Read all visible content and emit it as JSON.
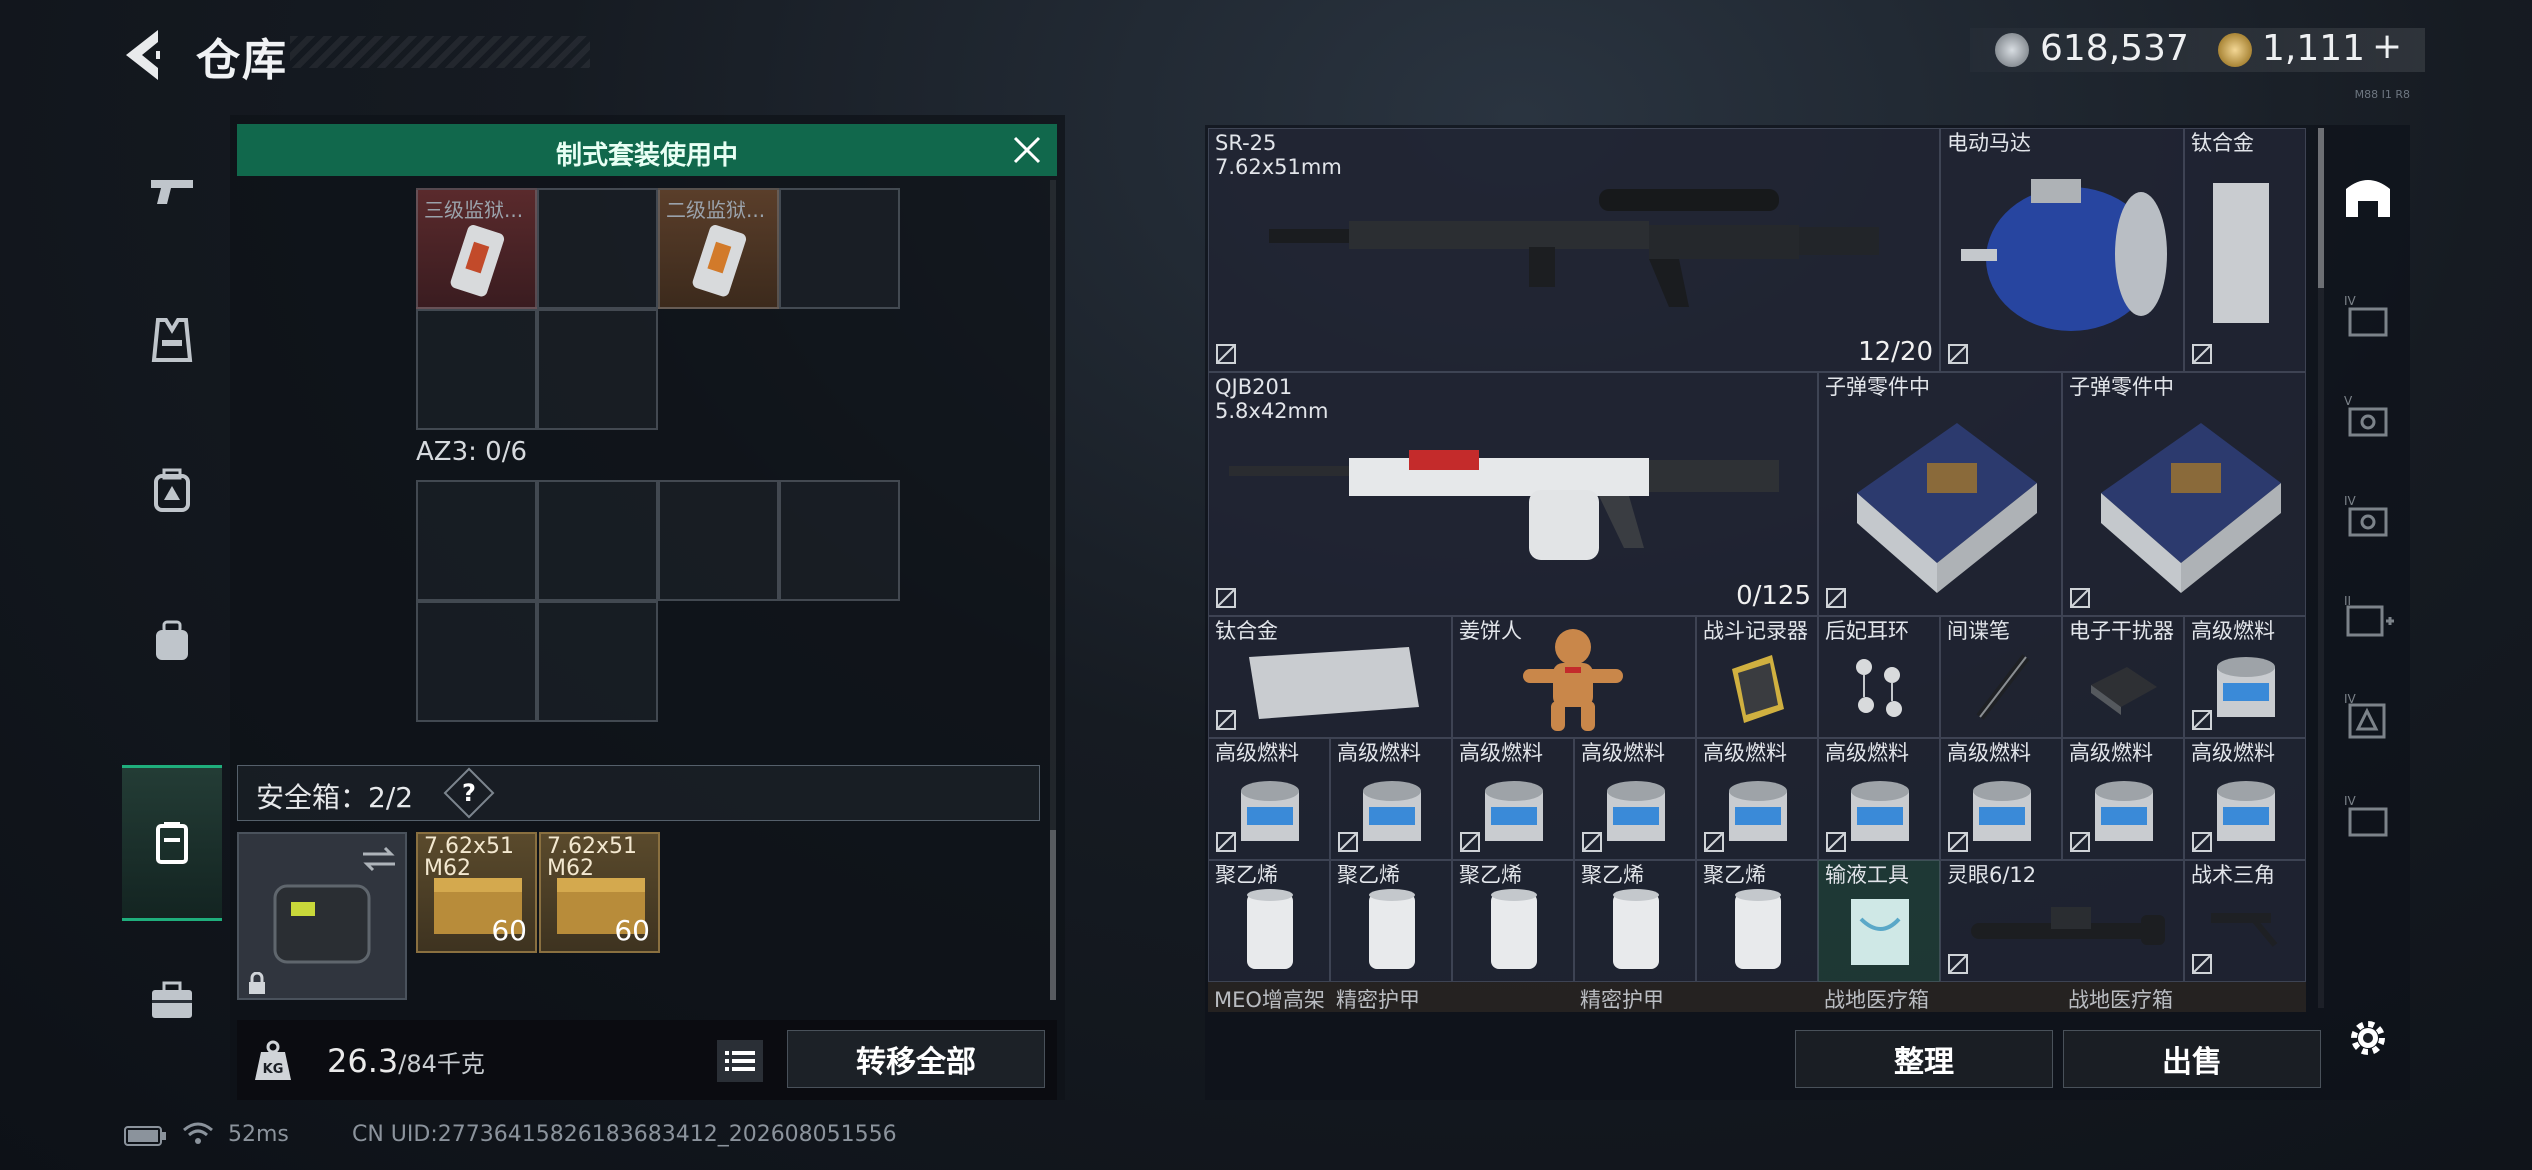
{
  "header": {
    "title": "仓库",
    "currency1": "618,537",
    "currency2": "1,111",
    "currency2_add": "+",
    "small_code": "M88 I1 R8"
  },
  "banner": {
    "text": "制式套装使用中"
  },
  "top_slots": [
    {
      "name": "三级监狱..."
    },
    {
      "name": "二级监狱..."
    }
  ],
  "az3_label": "AZ3: 0/6",
  "safebox": {
    "label": "安全箱：2/2",
    "help": "?"
  },
  "ammo": [
    {
      "name_line1": "7.62x51",
      "name_line2": "M62",
      "count": "60"
    },
    {
      "name_line1": "7.62x51",
      "name_line2": "M62",
      "count": "60"
    }
  ],
  "weight": {
    "current": "26.3",
    "max": "/84千克"
  },
  "buttons": {
    "transfer_all": "转移全部",
    "tidy": "整理",
    "sell": "出售"
  },
  "right_items": {
    "sr25": {
      "name": "SR-25",
      "sub": "7.62x51mm",
      "count": "12/20"
    },
    "motor": {
      "name": "电动马达"
    },
    "titanium1": {
      "name": "钛合金"
    },
    "qjb": {
      "name": "QJB201",
      "sub": "5.8x42mm",
      "count": "0/125"
    },
    "bullet_parts1": {
      "name": "子弹零件中"
    },
    "bullet_parts2": {
      "name": "子弹零件中"
    },
    "titanium2": {
      "name": "钛合金"
    },
    "gingerbread": {
      "name": "姜饼人"
    },
    "recorder": {
      "name": "战斗记录器"
    },
    "earring": {
      "name": "后妃耳环"
    },
    "spy_pen": {
      "name": "间谍笔"
    },
    "jammer": {
      "name": "电子干扰器"
    },
    "fuel_row3": {
      "name": "高级燃料"
    },
    "fuel_row4": [
      "高级燃料",
      "高级燃料",
      "高级燃料",
      "高级燃料",
      "高级燃料",
      "高级燃料",
      "高级燃料",
      "高级燃料",
      "高级燃料"
    ],
    "poly": [
      "聚乙烯",
      "聚乙烯",
      "聚乙烯",
      "聚乙烯",
      "聚乙烯"
    ],
    "iv_tool": {
      "name": "输液工具"
    },
    "scope": {
      "name": "灵眼6/12"
    },
    "tripod": {
      "name": "战术三角"
    },
    "bottom_labels": [
      "MEO增高架",
      "精密护甲",
      "精密护甲",
      "战地医疗箱",
      "战地医疗箱"
    ]
  },
  "footer": {
    "ping": "52ms",
    "uid": "CN UID:2773641582618368​3412_202608051556"
  }
}
